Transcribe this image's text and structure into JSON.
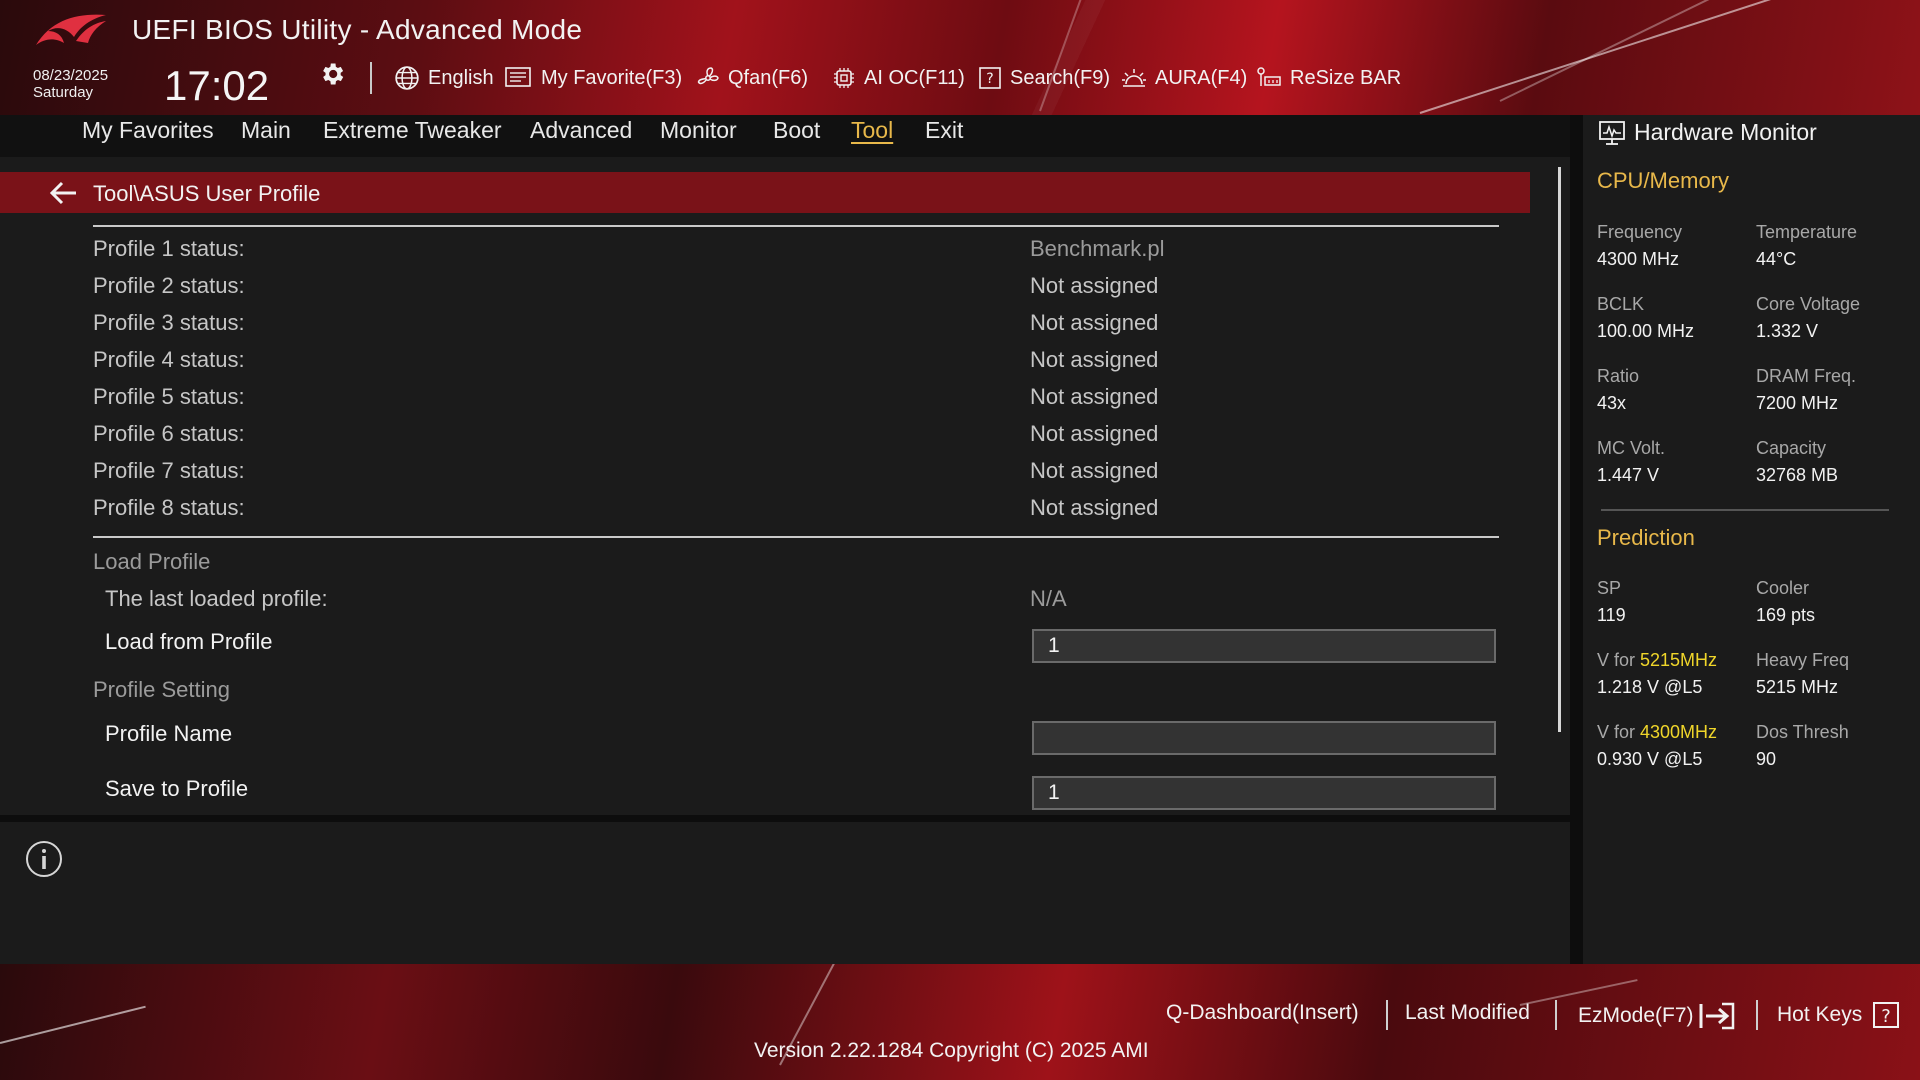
{
  "header": {
    "title": "UEFI BIOS Utility - Advanced Mode",
    "date": "08/23/2025",
    "weekday": "Saturday",
    "time": "17:02",
    "toolbar": {
      "language": "English",
      "my_favorite": "My Favorite(F3)",
      "qfan": "Qfan(F6)",
      "ai_oc": "AI OC(F11)",
      "search": "Search(F9)",
      "aura": "AURA(F4)",
      "resize_bar": "ReSize BAR"
    }
  },
  "menu": {
    "items": [
      "My Favorites",
      "Main",
      "Extreme Tweaker",
      "Advanced",
      "Monitor",
      "Boot",
      "Tool",
      "Exit"
    ],
    "active": "Tool"
  },
  "content": {
    "breadcrumb": "Tool\\ASUS User Profile",
    "profiles": [
      {
        "label": "Profile 1 status:",
        "value": "Benchmark.pl"
      },
      {
        "label": "Profile 2 status:",
        "value": "Not assigned"
      },
      {
        "label": "Profile 3 status:",
        "value": "Not assigned"
      },
      {
        "label": "Profile 4 status:",
        "value": "Not assigned"
      },
      {
        "label": "Profile 5 status:",
        "value": "Not assigned"
      },
      {
        "label": "Profile 6 status:",
        "value": "Not assigned"
      },
      {
        "label": "Profile 7 status:",
        "value": "Not assigned"
      },
      {
        "label": "Profile 8 status:",
        "value": "Not assigned"
      }
    ],
    "load_section": "Load Profile",
    "last_loaded_label": "The last loaded profile:",
    "last_loaded_value": "N/A",
    "load_from_label": "Load from Profile",
    "load_from_value": "1",
    "setting_section": "Profile Setting",
    "profile_name_label": "Profile Name",
    "profile_name_value": "",
    "save_label": "Save to Profile",
    "save_value": "1"
  },
  "hardware_monitor": {
    "title": "Hardware Monitor",
    "cpu_memory": {
      "title": "CPU/Memory",
      "frequency_label": "Frequency",
      "frequency_value": "4300 MHz",
      "temperature_label": "Temperature",
      "temperature_value": "44°C",
      "bclk_label": "BCLK",
      "bclk_value": "100.00 MHz",
      "core_voltage_label": "Core Voltage",
      "core_voltage_value": "1.332 V",
      "ratio_label": "Ratio",
      "ratio_value": "43x",
      "dram_freq_label": "DRAM Freq.",
      "dram_freq_value": "7200 MHz",
      "mc_volt_label": "MC Volt.",
      "mc_volt_value": "1.447 V",
      "capacity_label": "Capacity",
      "capacity_value": "32768 MB"
    },
    "prediction": {
      "title": "Prediction",
      "sp_label": "SP",
      "sp_value": "119",
      "cooler_label": "Cooler",
      "cooler_value": "169 pts",
      "v1_prefix": "V for ",
      "v1_freq": "5215MHz",
      "v1_value": "1.218 V @L5",
      "heavy_label": "Heavy Freq",
      "heavy_value": "5215 MHz",
      "v2_prefix": "V for ",
      "v2_freq": "4300MHz",
      "v2_value": "0.930 V @L5",
      "dos_label": "Dos Thresh",
      "dos_value": "90"
    }
  },
  "footer": {
    "q_dashboard": "Q-Dashboard(Insert)",
    "last_modified": "Last Modified",
    "ezmode": "EzMode(F7)",
    "hot_keys": "Hot Keys",
    "version": "Version 2.22.1284 Copyright (C) 2025 AMI"
  },
  "colors": {
    "accent_gold": "#e8b84a",
    "highlight_yellow": "#f0d62a",
    "breadcrumb_red": "#7a1218"
  }
}
